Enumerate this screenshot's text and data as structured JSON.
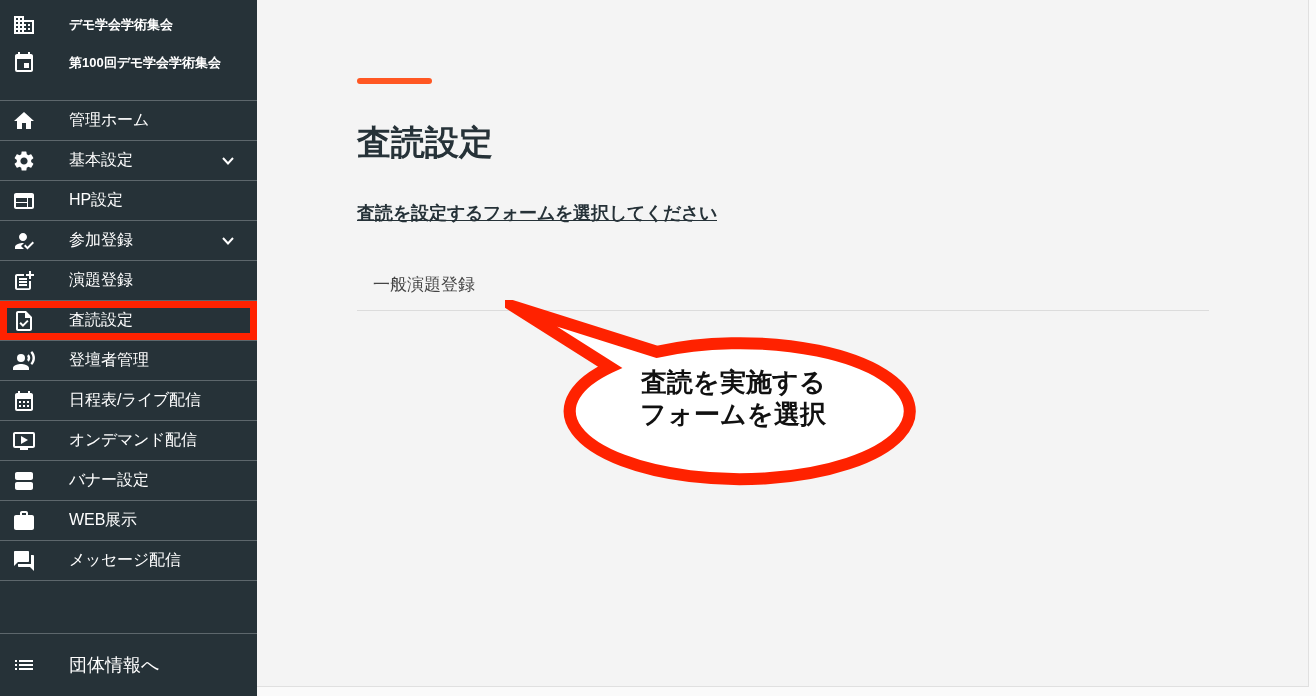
{
  "sidebar": {
    "header": [
      {
        "kind": "organization",
        "label": "デモ学会学術集会"
      },
      {
        "kind": "event",
        "label": "第100回デモ学会学術集会"
      }
    ],
    "items": [
      {
        "label": "管理ホーム",
        "expandable": false,
        "highlighted": false
      },
      {
        "label": "基本設定",
        "expandable": true,
        "highlighted": false
      },
      {
        "label": "HP設定",
        "expandable": false,
        "highlighted": false
      },
      {
        "label": "参加登録",
        "expandable": true,
        "highlighted": false
      },
      {
        "label": "演題登録",
        "expandable": false,
        "highlighted": false
      },
      {
        "label": "査読設定",
        "expandable": false,
        "highlighted": true
      },
      {
        "label": "登壇者管理",
        "expandable": false,
        "highlighted": false
      },
      {
        "label": "日程表/ライブ配信",
        "expandable": false,
        "highlighted": false
      },
      {
        "label": "オンデマンド配信",
        "expandable": false,
        "highlighted": false
      },
      {
        "label": "バナー設定",
        "expandable": false,
        "highlighted": false
      },
      {
        "label": "WEB展示",
        "expandable": false,
        "highlighted": false
      },
      {
        "label": "メッセージ配信",
        "expandable": false,
        "highlighted": false
      }
    ],
    "footer_link": {
      "label": "団体情報へ"
    }
  },
  "page": {
    "title": "査読設定",
    "instruction": "査読を設定するフォームを選択してください",
    "forms": [
      {
        "label": "一般演題登録"
      }
    ]
  },
  "callout": {
    "lines": [
      "査読を実施する",
      "フォームを選択"
    ]
  }
}
